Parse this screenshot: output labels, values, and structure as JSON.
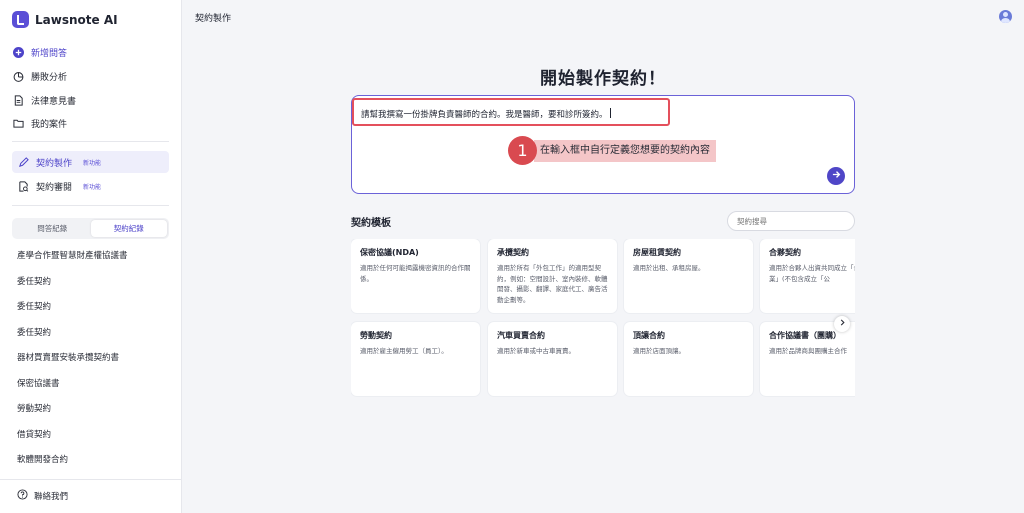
{
  "brand": {
    "name": "Lawsnote AI"
  },
  "sidebar": {
    "nav": [
      {
        "label": "新增問答",
        "icon": "plus-circle-icon"
      },
      {
        "label": "勝敗分析",
        "icon": "pie-chart-icon"
      },
      {
        "label": "法律意見書",
        "icon": "document-icon"
      },
      {
        "label": "我的案件",
        "icon": "folder-icon"
      }
    ],
    "tools": [
      {
        "label": "契約製作",
        "badge": "新功能",
        "icon": "pen-icon"
      },
      {
        "label": "契約審閱",
        "badge": "新功能",
        "icon": "review-document-icon"
      }
    ],
    "tabs": [
      {
        "label": "問答紀錄"
      },
      {
        "label": "契約紀錄"
      }
    ],
    "history": [
      "產學合作暨智慧財產權協議書",
      "委任契約",
      "委任契約",
      "委任契約",
      "器材買賣暨安裝承攬契約書",
      "保密協議書",
      "勞動契約",
      "借貸契約",
      "軟體開發合約"
    ],
    "contact_label": "聯絡我們"
  },
  "header": {
    "breadcrumb": "契約製作"
  },
  "main": {
    "title": "開始製作契約！",
    "input_value": "請幫我撰寫一份掛牌負責醫師的合約。我是醫師，要和診所簽約。",
    "step_number": "1",
    "step_label": "在輸入框中自行定義您想要的契約內容",
    "templates_title": "契約模板",
    "search_placeholder": "契約搜尋",
    "cards": [
      {
        "title": "保密協議(NDA)",
        "desc": "適用於任何可能揭露機密資訊的合作關係。"
      },
      {
        "title": "承攬契約",
        "desc": "適用於所有「外包工作」的適用型契約，例如：空間設計、室內裝修、軟體開發、攝影、翻譯、家庭代工、廣告活動企劃等。"
      },
      {
        "title": "房屋租賃契約",
        "desc": "適用於出租、承租房屋。"
      },
      {
        "title": "合夥契約",
        "desc": "適用於合夥人出資共同成立「合夥事業」(不包含成立「公"
      },
      {
        "title": "勞動契約",
        "desc": "適用於雇主僱用勞工（員工）。"
      },
      {
        "title": "汽車買賣合約",
        "desc": "適用於新車或中古車買賣。"
      },
      {
        "title": "頂讓合約",
        "desc": "適用於店面頂讓。"
      },
      {
        "title": "合作協議書（團購）",
        "desc": "適用於品牌商與團購主合作"
      }
    ]
  },
  "colors": {
    "accent": "#5b4fd6",
    "annotation": "#d94a50"
  }
}
